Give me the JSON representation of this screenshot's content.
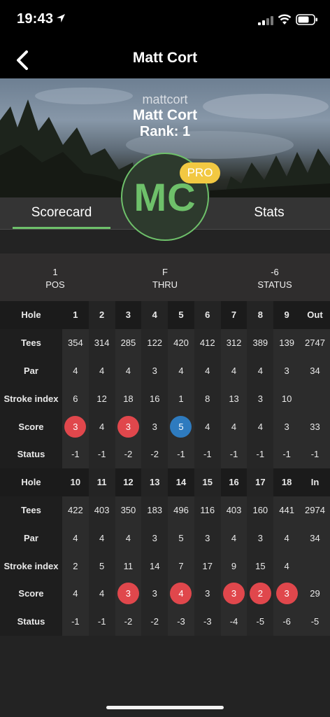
{
  "status_bar": {
    "time": "19:43"
  },
  "nav": {
    "title": "Matt Cort"
  },
  "profile": {
    "username": "mattcort",
    "name": "Matt Cort",
    "rank": "Rank: 1",
    "initials": "MC",
    "badge": "PRO"
  },
  "tabs": {
    "scorecard": "Scorecard",
    "stats": "Stats"
  },
  "summary": [
    {
      "value": "1",
      "label": "POS"
    },
    {
      "value": "F",
      "label": "THRU"
    },
    {
      "value": "-6",
      "label": "STATUS"
    }
  ],
  "scorecard": {
    "front": {
      "hole_label": "Hole",
      "holes": [
        "1",
        "2",
        "3",
        "4",
        "5",
        "6",
        "7",
        "8",
        "9"
      ],
      "total_label": "Out",
      "tees_label": "Tees",
      "tees": [
        "354",
        "314",
        "285",
        "122",
        "420",
        "412",
        "312",
        "389",
        "139"
      ],
      "tees_total": "2747",
      "par_label": "Par",
      "par": [
        "4",
        "4",
        "4",
        "3",
        "4",
        "4",
        "4",
        "4",
        "3"
      ],
      "par_total": "34",
      "si_label": "Stroke index",
      "si": [
        "6",
        "12",
        "18",
        "16",
        "1",
        "8",
        "13",
        "3",
        "10"
      ],
      "si_total": "",
      "score_label": "Score",
      "score": [
        "3",
        "4",
        "3",
        "3",
        "5",
        "4",
        "4",
        "4",
        "3"
      ],
      "score_total": "33",
      "score_marks": [
        "red",
        "",
        "red",
        "",
        "blue",
        "",
        "",
        "",
        ""
      ],
      "status_label": "Status",
      "status": [
        "-1",
        "-1",
        "-2",
        "-2",
        "-1",
        "-1",
        "-1",
        "-1",
        "-1"
      ],
      "status_total": "-1"
    },
    "back": {
      "hole_label": "Hole",
      "holes": [
        "10",
        "11",
        "12",
        "13",
        "14",
        "15",
        "16",
        "17",
        "18"
      ],
      "total_label": "In",
      "tees_label": "Tees",
      "tees": [
        "422",
        "403",
        "350",
        "183",
        "496",
        "116",
        "403",
        "160",
        "441"
      ],
      "tees_total": "2974",
      "par_label": "Par",
      "par": [
        "4",
        "4",
        "4",
        "3",
        "5",
        "3",
        "4",
        "3",
        "4"
      ],
      "par_total": "34",
      "si_label": "Stroke index",
      "si": [
        "2",
        "5",
        "11",
        "14",
        "7",
        "17",
        "9",
        "15",
        "4"
      ],
      "si_total": "",
      "score_label": "Score",
      "score": [
        "4",
        "4",
        "3",
        "3",
        "4",
        "3",
        "3",
        "2",
        "3"
      ],
      "score_total": "29",
      "score_marks": [
        "",
        "",
        "red",
        "",
        "red",
        "",
        "red",
        "red",
        "red"
      ],
      "status_label": "Status",
      "status": [
        "-1",
        "-1",
        "-2",
        "-2",
        "-3",
        "-3",
        "-4",
        "-5",
        "-6"
      ],
      "status_total": "-5"
    }
  },
  "colors": {
    "accent_green": "#6ec06a",
    "birdie_red": "#e0474c",
    "bogey_blue": "#2e7bbf",
    "pro_yellow": "#f2c842"
  }
}
